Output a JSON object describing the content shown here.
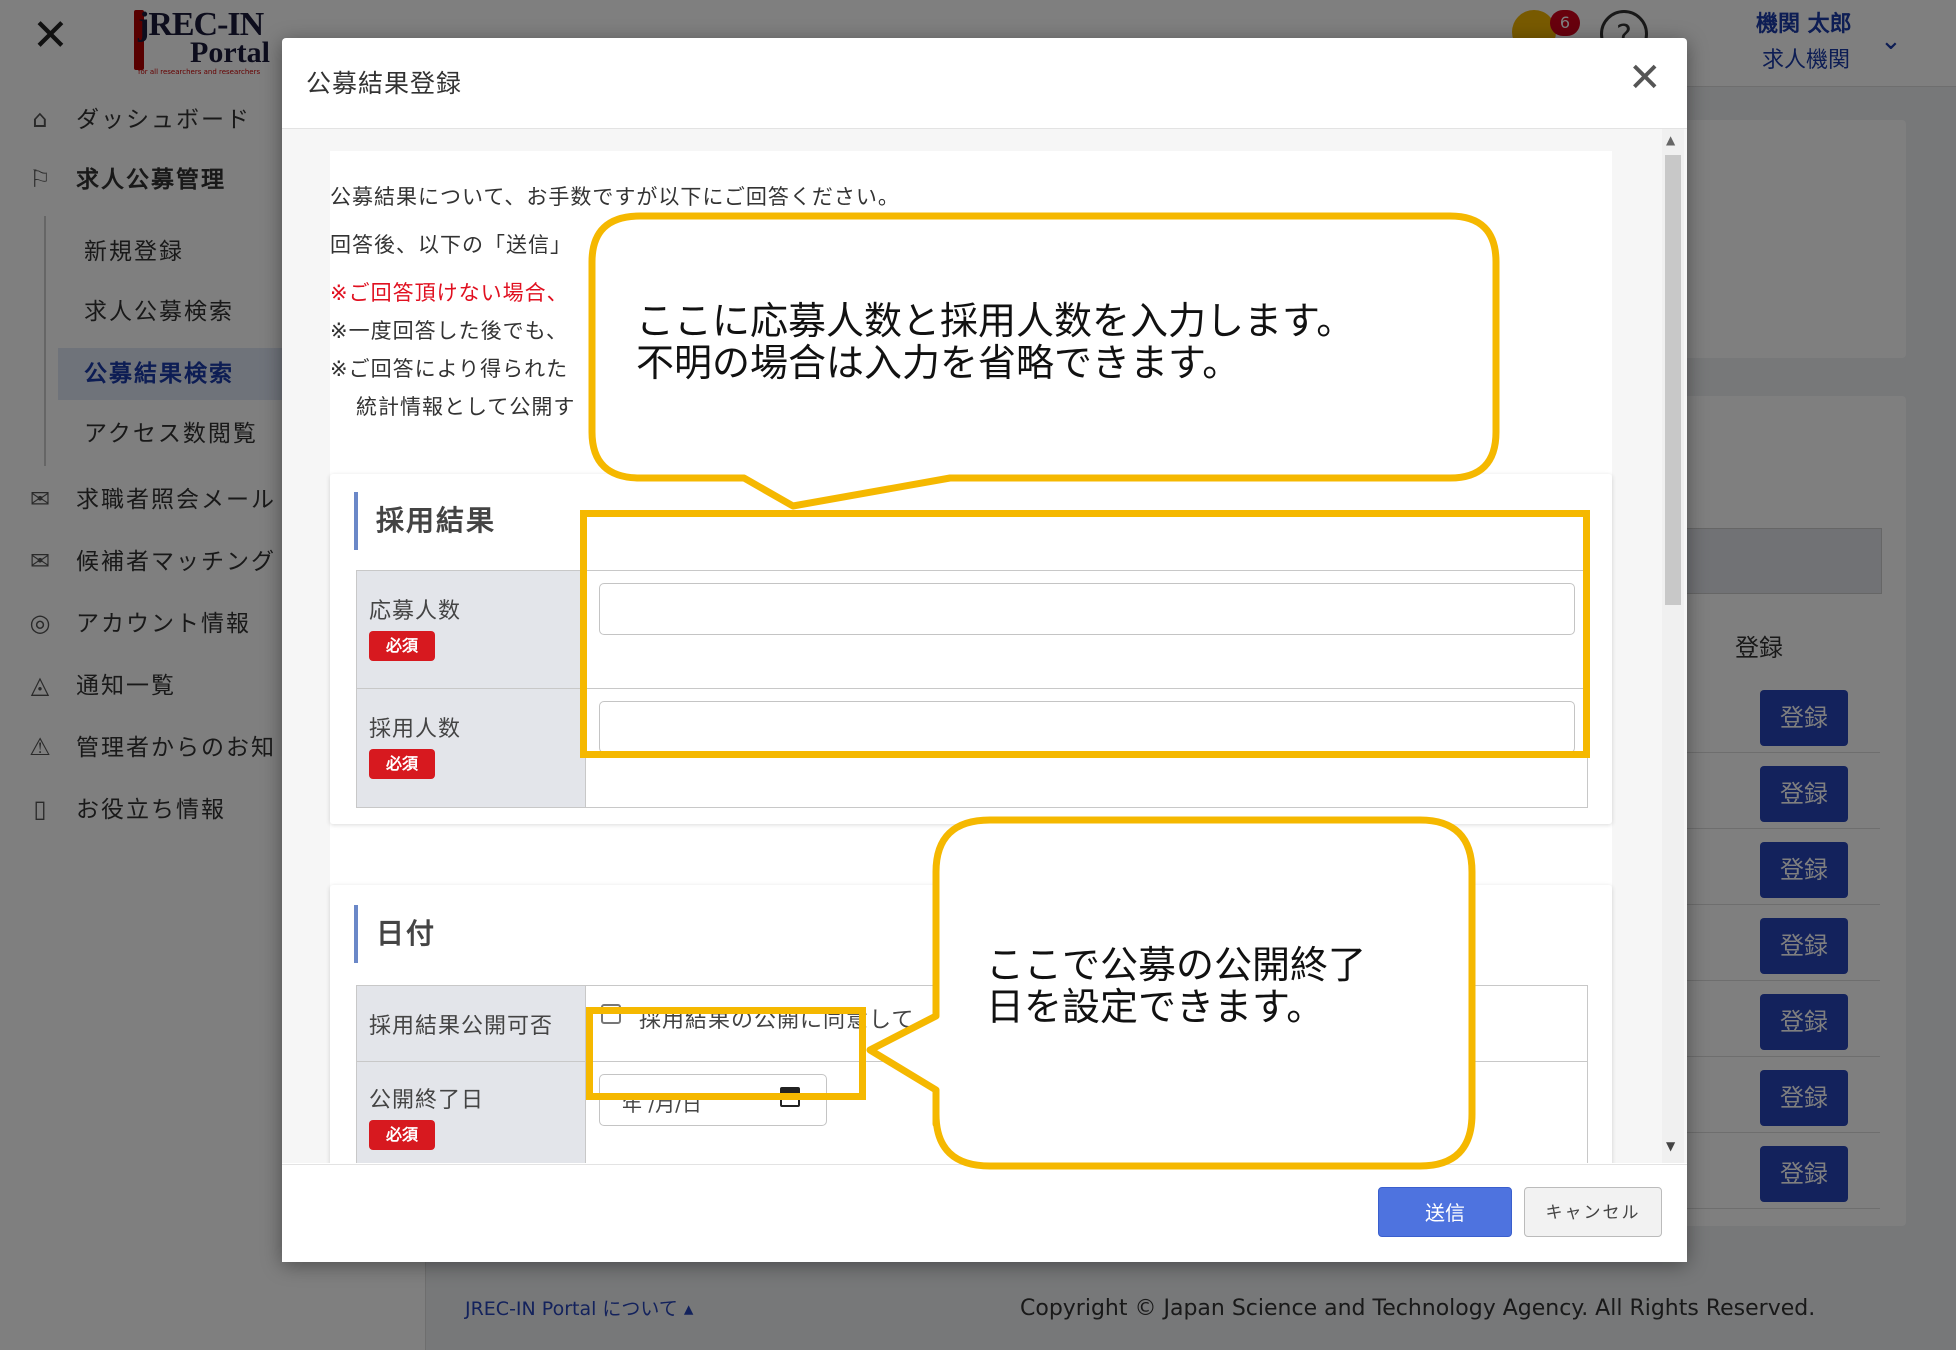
{
  "header": {
    "close_glyph": "✕",
    "logo_line1": "jREC-IN",
    "logo_line2": "Portal",
    "logo_tagline": "for all researchers and researchers",
    "notification_count": "6",
    "help_glyph": "?",
    "user_name": "機関 太郎",
    "user_org": "求人機関",
    "chevron_glyph": "⌄"
  },
  "sidebar": {
    "items": [
      {
        "icon": "home-icon",
        "glyph": "⌂",
        "label": "ダッシュボード"
      },
      {
        "icon": "signpost-icon",
        "glyph": "⚐",
        "label": "求人公募管理"
      },
      {
        "icon": "mail-icon",
        "glyph": "✉",
        "label": "求職者照会メール"
      },
      {
        "icon": "envelope-open-icon",
        "glyph": "✉",
        "label": "候補者マッチング"
      },
      {
        "icon": "user-icon",
        "glyph": "◎",
        "label": "アカウント情報"
      },
      {
        "icon": "bell-icon",
        "glyph": "◬",
        "label": "通知一覧"
      },
      {
        "icon": "warning-icon",
        "glyph": "⚠",
        "label": "管理者からのお知"
      },
      {
        "icon": "book-icon",
        "glyph": "▯",
        "label": "お役立ち情報"
      }
    ],
    "subitems": [
      "新規登録",
      "求人公募検索",
      "公募結果検索",
      "アクセス数閲覧"
    ],
    "active_subitem": "公募結果検索"
  },
  "background_table": {
    "header_label": "登録",
    "row_button_label": "登録",
    "row_count": 7
  },
  "footer": {
    "link": "JREC-IN Portal について ▴",
    "copyright": "Copyright © Japan Science and Technology Agency. All Rights Reserved."
  },
  "modal": {
    "title": "公募結果登録",
    "close_glyph": "✕",
    "intro": [
      {
        "text": "公募結果について、お手数ですが以下にご回答ください。",
        "red": false
      },
      {
        "text": "回答後、以下の「送信」",
        "red": false
      },
      {
        "text": "※ご回答頂けない場合、",
        "red": true
      },
      {
        "text": "※一度回答した後でも、",
        "red": false
      },
      {
        "text": "※ご回答により得られた",
        "red": false
      },
      {
        "text": "統計情報として公開す",
        "red": false
      }
    ],
    "section_result": {
      "title": "採用結果",
      "fields": [
        {
          "label": "応募人数",
          "required": "必須",
          "value": ""
        },
        {
          "label": "採用人数",
          "required": "必須",
          "value": ""
        }
      ]
    },
    "section_date": {
      "title": "日付",
      "consent_label": "採用結果公開可否",
      "consent_text": "採用結果の公開に同意して",
      "end_date_label": "公開終了日",
      "end_date_required": "必須",
      "end_date_placeholder": "年 /月/日"
    },
    "submit_label": "送信",
    "cancel_label": "キャンセル",
    "scroll_up_glyph": "▲",
    "scroll_down_glyph": "▼"
  },
  "annotations": {
    "callout_top": "ここに応募人数と採用人数を入力します。\n不明の場合は入力を省略できます。",
    "callout_bottom": "ここで公募の公開終了\n日を設定できます。",
    "highlight_color": "#f5b800"
  }
}
